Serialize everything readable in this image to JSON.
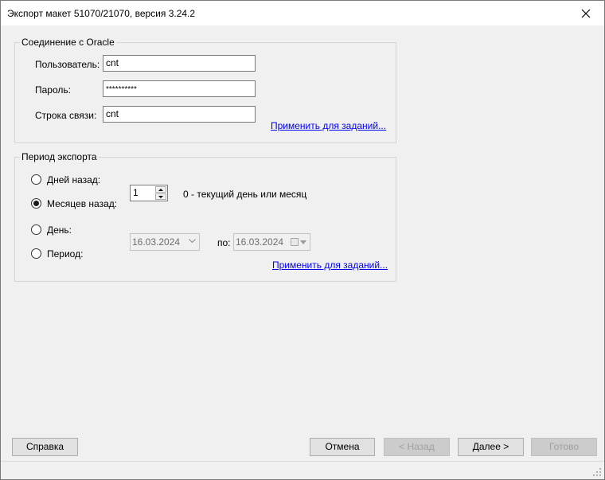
{
  "window": {
    "title": "Экспорт макет 51070/21070, версия 3.24.2"
  },
  "oracle_group": {
    "legend": "Соединение с Oracle",
    "user_label": "Пользователь:",
    "user_value": "cnt",
    "password_label": "Пароль:",
    "password_value": "**********",
    "conn_label": "Строка связи:",
    "conn_value": "cnt",
    "apply_link": "Применить для заданий..."
  },
  "period_group": {
    "legend": "Период экспорта",
    "radio_days_label": "Дней назад:",
    "radio_months_label": "Месяцев назад:",
    "radio_day_label": "День:",
    "radio_period_label": "Период:",
    "selected": "months",
    "spin_value": "1",
    "hint": "0 - текущий день или месяц",
    "date_from": "16.03.2024",
    "to_label": "по:",
    "date_to": "16.03.2024",
    "apply_link": "Применить для заданий..."
  },
  "buttons": {
    "help": "Справка",
    "cancel": "Отмена",
    "back": "< Назад",
    "next": "Далее >",
    "finish": "Готово"
  },
  "colors": {
    "link": "#0000ee",
    "window_bg": "#f0f0f0",
    "disabled_text": "#a0a0a0"
  }
}
